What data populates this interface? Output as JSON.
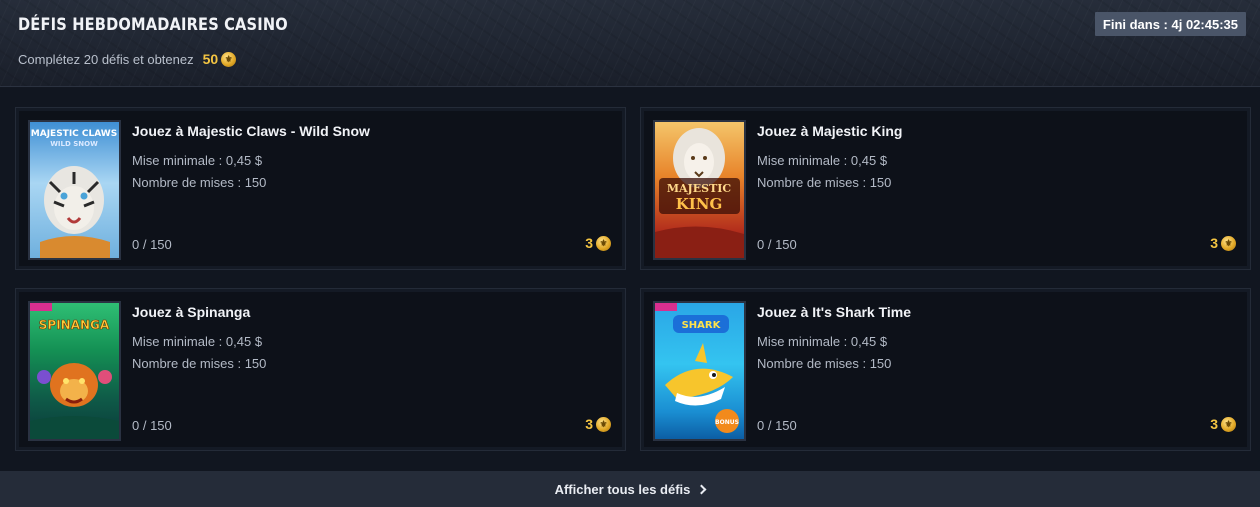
{
  "header": {
    "title": "DÉFIS HEBDOMADAIRES CASINO",
    "subtitle": "Complétez 20 défis et obtenez",
    "reward": "50",
    "timer": "Fini dans : 4j 02:45:35"
  },
  "challenges": [
    {
      "title": "Jouez à Majestic Claws - Wild Snow",
      "min_bet": "Mise minimale : 0,45 $",
      "bet_count": "Nombre de mises : 150",
      "progress": "0 / 150",
      "points": "3",
      "art_text": [
        "MAJESTIC CLAWS",
        "WILD SNOW"
      ]
    },
    {
      "title": "Jouez à Majestic King",
      "min_bet": "Mise minimale : 0,45 $",
      "bet_count": "Nombre de mises : 150",
      "progress": "0 / 150",
      "points": "3",
      "art_text": [
        "MAJESTIC",
        "KING"
      ]
    },
    {
      "title": "Jouez à Spinanga",
      "min_bet": "Mise minimale : 0,45 $",
      "bet_count": "Nombre de mises : 150",
      "progress": "0 / 150",
      "points": "3",
      "art_text": [
        "SPINANGA"
      ]
    },
    {
      "title": "Jouez à It's Shark Time",
      "min_bet": "Mise minimale : 0,45 $",
      "bet_count": "Nombre de mises : 150",
      "progress": "0 / 150",
      "points": "3",
      "art_text": [
        "SHARK",
        "BONUS"
      ]
    }
  ],
  "footer": {
    "link_label": "Afficher tous les défis"
  },
  "colors": {
    "accent_gold": "#f4c542",
    "timer_bg": "#4a5568",
    "card_bg": "#0d1119"
  },
  "icons": {
    "coin": "coin-icon",
    "chevron": "chevron-right-icon"
  }
}
